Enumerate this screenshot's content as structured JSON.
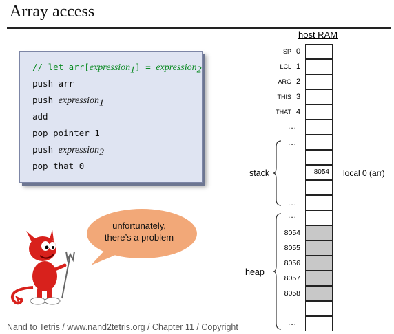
{
  "title": "Array access",
  "code": {
    "comment_prefix": "// let arr[",
    "comment_expr1": "expression",
    "comment_expr1_sub": "1",
    "comment_mid": "] = ",
    "comment_expr2": "expression",
    "comment_expr2_sub": "2",
    "line_push_arr": "push arr",
    "line_push_expr1_kw": "push",
    "line_push_expr1": "expression",
    "line_push_expr1_sub": "1",
    "line_add": "add",
    "line_pop_pointer": "pop pointer 1",
    "line_push_expr2_kw": "push",
    "line_push_expr2": "expression",
    "line_push_expr2_sub": "2",
    "line_pop_that": "pop that 0"
  },
  "ram": {
    "header": "host RAM",
    "registers": [
      {
        "name": "SP",
        "index": "0"
      },
      {
        "name": "LCL",
        "index": "1"
      },
      {
        "name": "ARG",
        "index": "2"
      },
      {
        "name": "THIS",
        "index": "3"
      },
      {
        "name": "THAT",
        "index": "4"
      }
    ],
    "dots": "...",
    "stack_label": "stack",
    "heap_label": "heap",
    "stack_cell_value": "8054",
    "local_label": "local 0   (arr)",
    "heap_addresses": [
      "8054",
      "8055",
      "8056",
      "8057",
      "8058"
    ]
  },
  "bubble": {
    "line1": "unfortunately,",
    "line2": "there’s a problem"
  },
  "footer": "Nand to Tetris / www.nand2tetris.org / Chapter 11 / Copyright",
  "colors": {
    "codebox_bg": "#dfe4f2",
    "comment_green": "#0a8a22",
    "bubble_fill": "#f2a878",
    "heap_cell_gray": "#c8c8c8",
    "devil_red": "#d8211c"
  }
}
